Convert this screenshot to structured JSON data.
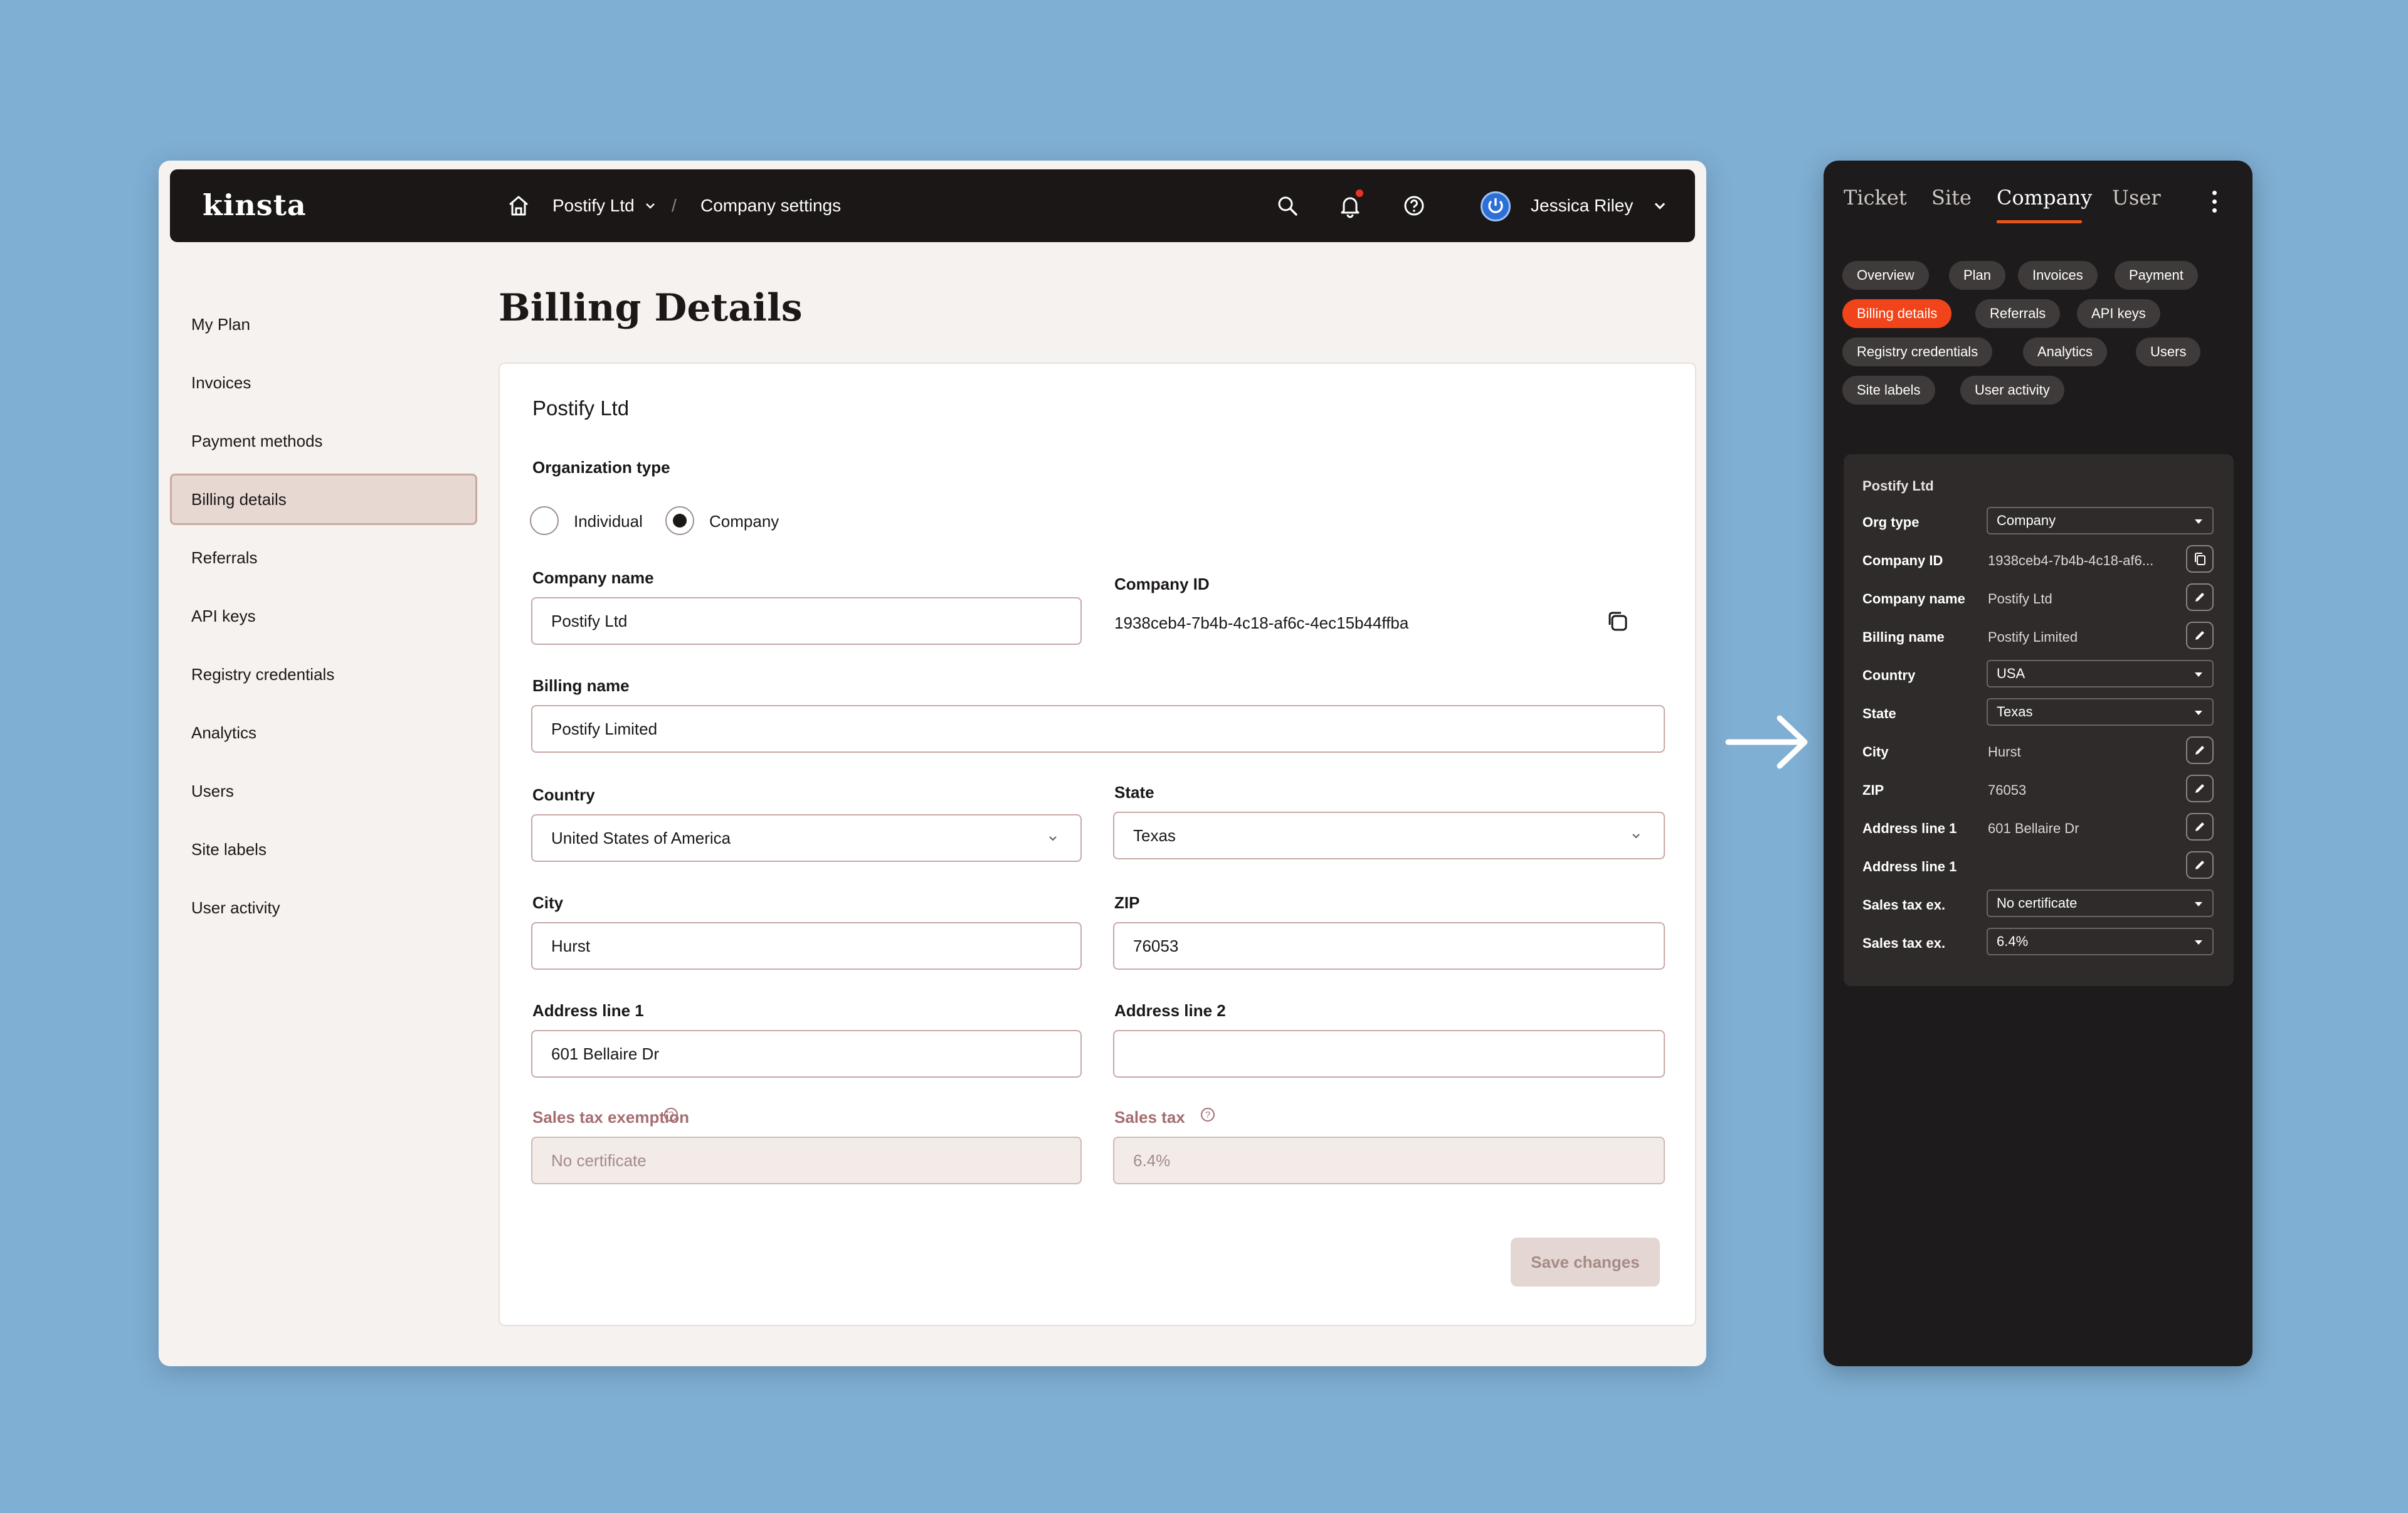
{
  "header": {
    "logo": "kinsta",
    "breadcrumb_company": "Postify Ltd",
    "breadcrumb_separator": "/",
    "breadcrumb_page": "Company settings",
    "user_name": "Jessica Riley"
  },
  "sidebar": {
    "items": [
      {
        "label": "My Plan"
      },
      {
        "label": "Invoices"
      },
      {
        "label": "Payment methods"
      },
      {
        "label": "Billing details",
        "active": true
      },
      {
        "label": "Referrals"
      },
      {
        "label": "API keys"
      },
      {
        "label": "Registry credentials"
      },
      {
        "label": "Analytics"
      },
      {
        "label": "Users"
      },
      {
        "label": "Site labels"
      },
      {
        "label": "User activity"
      }
    ]
  },
  "page": {
    "title": "Billing Details"
  },
  "form": {
    "company_header": "Postify Ltd",
    "org_type_label": "Organization type",
    "org_type_options": [
      "Individual",
      "Company"
    ],
    "org_type_selected": "Company",
    "company_name_label": "Company name",
    "company_name_value": "Postify Ltd",
    "company_id_label": "Company ID",
    "company_id_value": "1938ceb4-7b4b-4c18-af6c-4ec15b44ffba",
    "billing_name_label": "Billing name",
    "billing_name_value": "Postify Limited",
    "country_label": "Country",
    "country_value": "United States of America",
    "state_label": "State",
    "state_value": "Texas",
    "city_label": "City",
    "city_value": "Hurst",
    "zip_label": "ZIP",
    "zip_value": "76053",
    "address1_label": "Address line 1",
    "address1_value": "601 Bellaire Dr",
    "address2_label": "Address line 2",
    "address2_value": "",
    "sales_tax_exemption_label": "Sales tax exemption",
    "sales_tax_exemption_value": "No certificate",
    "sales_tax_label": "Sales tax",
    "sales_tax_value": "6.4%",
    "save_label": "Save changes"
  },
  "panel": {
    "tabs": [
      "Ticket",
      "Site",
      "Company",
      "User"
    ],
    "active_tab": "Company",
    "chips": [
      "Overview",
      "Plan",
      "Invoices",
      "Payment",
      "Billing details",
      "Referrals",
      "API keys",
      "Registry credentials",
      "Analytics",
      "Users",
      "Site labels",
      "User activity"
    ],
    "active_chip": "Billing details",
    "card_title": "Postify Ltd",
    "rows": [
      {
        "label": "Org type",
        "value": "Company",
        "kind": "select"
      },
      {
        "label": "Company ID",
        "value": "1938ceb4-7b4b-4c18-af6...",
        "kind": "copy"
      },
      {
        "label": "Company name",
        "value": "Postify Ltd",
        "kind": "edit"
      },
      {
        "label": "Billing name",
        "value": "Postify Limited",
        "kind": "edit"
      },
      {
        "label": "Country",
        "value": "USA",
        "kind": "select"
      },
      {
        "label": "State",
        "value": "Texas",
        "kind": "select"
      },
      {
        "label": "City",
        "value": "Hurst",
        "kind": "edit"
      },
      {
        "label": "ZIP",
        "value": "76053",
        "kind": "edit"
      },
      {
        "label": "Address line 1",
        "value": "601 Bellaire Dr",
        "kind": "edit"
      },
      {
        "label": "Address line 1",
        "value": "",
        "kind": "edit"
      },
      {
        "label": "Sales tax ex.",
        "value": "No certificate",
        "kind": "select"
      },
      {
        "label": "Sales tax ex.",
        "value": "6.4%",
        "kind": "select"
      }
    ]
  },
  "colors": {
    "background": "#7fafd3",
    "topbar": "#1c1717",
    "accent_orange": "#f1441a",
    "sidebar_active": "#e7d8d1",
    "panel_bg": "#1d1b1b"
  }
}
